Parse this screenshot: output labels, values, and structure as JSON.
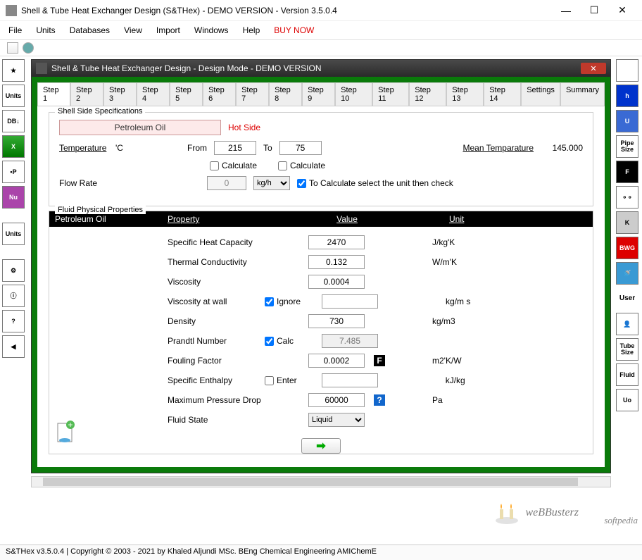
{
  "titlebar": {
    "text": "Shell & Tube Heat Exchanger Design (S&THex) - DEMO VERSION - Version 3.5.0.4"
  },
  "menubar": {
    "file": "File",
    "units": "Units",
    "databases": "Databases",
    "view": "View",
    "import": "Import",
    "windows": "Windows",
    "help": "Help",
    "buy": "BUY NOW"
  },
  "mdi": {
    "title": "Shell & Tube Heat Exchanger Design - Design Mode - DEMO VERSION"
  },
  "tabs": [
    "Step 1",
    "Step 2",
    "Step 3",
    "Step 4",
    "Step 5",
    "Step 6",
    "Step 7",
    "Step 8",
    "Step 9",
    "Step 10",
    "Step 11",
    "Step 12",
    "Step 13",
    "Step 14",
    "Settings",
    "Summary"
  ],
  "shell": {
    "legend": "Shell Side Specifications",
    "fluid": "Petroleum Oil",
    "hotside": "Hot Side",
    "temp_label": "Temperature",
    "temp_unit": "'C",
    "from": "From",
    "from_v": "215",
    "to": "To",
    "to_v": "75",
    "calc": "Calculate",
    "mean_label": "Mean Temparature",
    "mean_v": "145.000",
    "flow_label": "Flow Rate",
    "flow_v": "0",
    "flow_unit": "kg/h",
    "flow_hint": "To Calculate select the unit then check"
  },
  "props": {
    "legend": "Fluid Physical Properties",
    "fluidname": "Petroleum Oil",
    "h_prop": "Property",
    "h_val": "Value",
    "h_unit": "Unit",
    "rows": [
      {
        "name": "Specific Heat Capacity",
        "val": "2470",
        "unit": "J/kg'K"
      },
      {
        "name": "Thermal Conductivity",
        "val": "0.132",
        "unit": "W/m'K"
      },
      {
        "name": "Viscosity",
        "val": "0.0004",
        "unit": ""
      },
      {
        "name": "Viscosity at wall",
        "chk": "Ignore",
        "val": "",
        "unit": "kg/m s"
      },
      {
        "name": "Density",
        "val": "730",
        "unit": "kg/m3"
      },
      {
        "name": "Prandtl Number",
        "chk": "Calc",
        "val": "7.485",
        "ro": true,
        "unit": ""
      },
      {
        "name": "Fouling Factor",
        "val": "0.0002",
        "badge": "F",
        "unit": "m2'K/W"
      },
      {
        "name": "Specific Enthalpy",
        "chk": "Enter",
        "unchecked": true,
        "val": "",
        "unit": "kJ/kg"
      },
      {
        "name": "Maximum Pressure Drop",
        "val": "60000",
        "badge": "?",
        "unit": "Pa"
      },
      {
        "name": "Fluid State",
        "select": "Liquid",
        "unit": ""
      }
    ]
  },
  "left_rail": [
    "★",
    "Units",
    "DB↓",
    "X",
    "•P",
    "Nu",
    "",
    "Units",
    "",
    "⚙",
    "ⓘ",
    "?",
    "◀"
  ],
  "right_rail": [
    {
      "t": "",
      "bg": "#fff"
    },
    {
      "t": "h",
      "bg": "#0033cc",
      "c": "#fff"
    },
    {
      "t": "U",
      "bg": "#3a6ad4",
      "c": "#fff"
    },
    {
      "t": "Pipe\nSize",
      "bg": "#fff"
    },
    {
      "t": "F",
      "bg": "#000",
      "c": "#fff"
    },
    {
      "t": "⚬⚬",
      "bg": "#fff"
    },
    {
      "t": "K",
      "bg": "#ccc"
    },
    {
      "t": "BWG",
      "bg": "#d00",
      "c": "#fff"
    },
    {
      "t": "🚿",
      "bg": "#3a9ad4"
    },
    {
      "t": "User",
      "bg": "#fff",
      "plain": true
    },
    {
      "t": "👤",
      "bg": "#fff"
    },
    {
      "t": "Tube\nSize",
      "bg": "#fff"
    },
    {
      "t": "Fluid",
      "bg": "#fff"
    },
    {
      "t": "Uo",
      "bg": "#fff"
    }
  ],
  "watermark": "weBBusterz",
  "softpedia": "softpedia",
  "status": "S&THex  v3.5.0.4  |  Copyright © 2003 - 2021 by Khaled Aljundi MSc. BEng Chemical Engineering AMIChemE"
}
